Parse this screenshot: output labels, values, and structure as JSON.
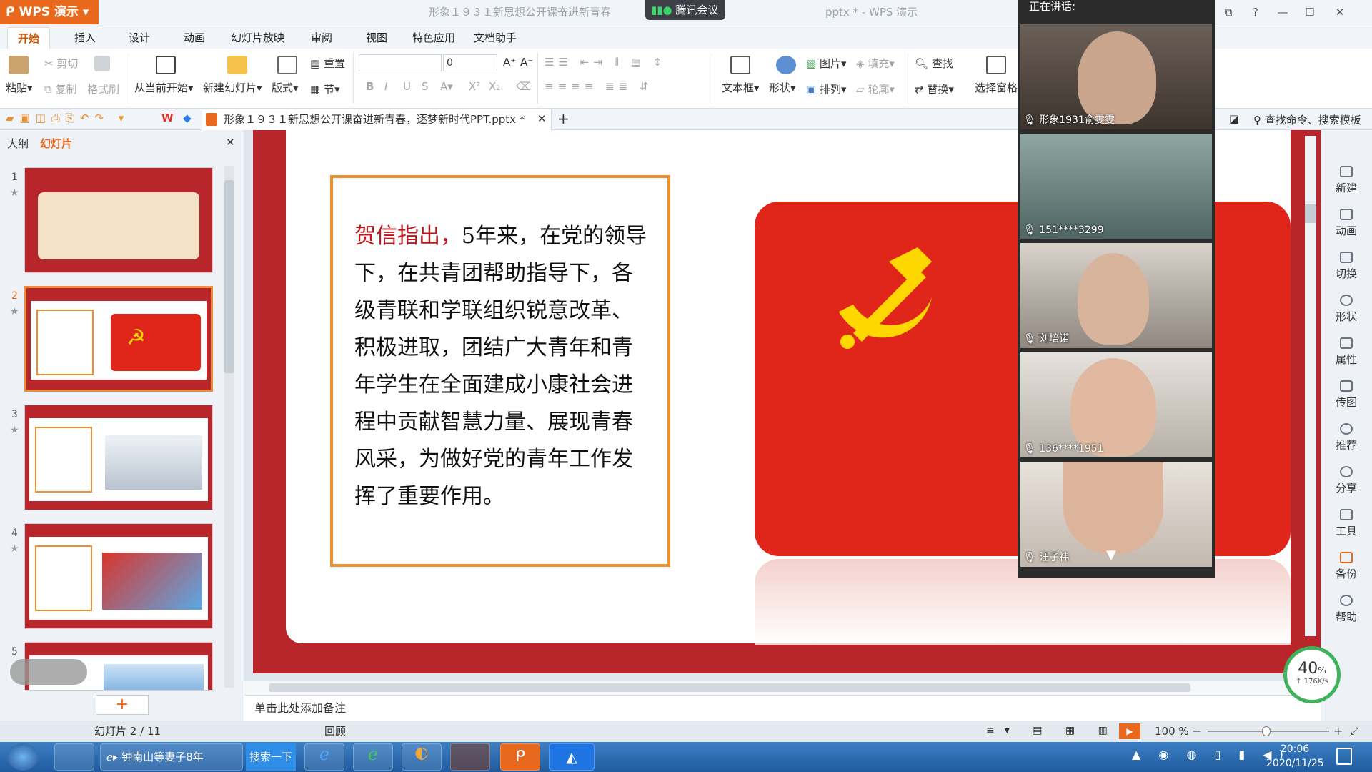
{
  "app": {
    "name": "WPS 演示",
    "window_title": "形象１９３１新思想公开课奋进新青春，逐梦新时代PPT.pptx * - WPS 演示",
    "window_title_left": "形象１９３１新思想公开课奋进新青春",
    "window_title_right": "pptx * - WPS 演示",
    "meeting_label": "腾讯会议"
  },
  "menu_tabs": [
    "开始",
    "插入",
    "设计",
    "动画",
    "幻灯片放映",
    "审阅",
    "视图",
    "特色应用",
    "文档助手"
  ],
  "ribbon": {
    "paste": "粘贴",
    "cut": "剪切",
    "copy": "复制",
    "format_painter": "格式刷",
    "from_current": "从当前开始",
    "new_slide": "新建幻灯片",
    "layout": "版式",
    "reset": "重置",
    "section": "节",
    "font_size_value": "0",
    "text_box": "文本框",
    "shape": "形状",
    "picture": "图片",
    "fill": "填充",
    "arrange": "排列",
    "outline": "轮廓",
    "find": "查找",
    "replace": "替换",
    "selection_pane": "选择窗格"
  },
  "doc_tab": {
    "title": "形象１９３１新思想公开课奋进新青春，逐梦新时代PPT.pptx *"
  },
  "search_cmd": "查找命令、搜索模板",
  "left_panel": {
    "tab_outline": "大纲",
    "tab_slides": "幻灯片",
    "thumbnails": [
      {
        "num": "1"
      },
      {
        "num": "2"
      },
      {
        "num": "3"
      },
      {
        "num": "4"
      },
      {
        "num": "5"
      }
    ],
    "add_button": "+"
  },
  "slide": {
    "lead": "贺信指出，",
    "body": "5年来，在党的领导下，在共青团帮助指导下，各级青联和学联组织锐意改革、积极进取，团结广大青年和青年学生在全面建成小康社会进程中贡献智慧力量、展现青春风采，为做好党的青年工作发挥了重要作用。"
  },
  "video_panel": {
    "title": "正在讲话:",
    "participants": [
      {
        "name": "形象1931俞雯雯"
      },
      {
        "name": "151****3299"
      },
      {
        "name": "刘培诺"
      },
      {
        "name": "136****1951"
      },
      {
        "name": "汪子祎"
      }
    ]
  },
  "right_sidebar": [
    "新建",
    "动画",
    "切换",
    "形状",
    "属性",
    "传图",
    "推荐",
    "分享",
    "工具",
    "备份",
    "帮助"
  ],
  "notes_placeholder": "单击此处添加备注",
  "status": {
    "slide_counter": "幻灯片 2 / 11",
    "theme": "回顾",
    "zoom": "100 %"
  },
  "net_meter": {
    "percent": "40",
    "percent_sign": "%",
    "speed": "↑ 176K/s"
  },
  "taskbar": {
    "ie_tab": "钟南山等妻子8年",
    "search_button": "搜索一下",
    "time": "20:06",
    "date": "2020/11/25"
  },
  "colors": {
    "accent": "#e8681d",
    "slide_red": "#e0261b",
    "border_orange": "#e8912e",
    "emblem": "#ffd700"
  }
}
